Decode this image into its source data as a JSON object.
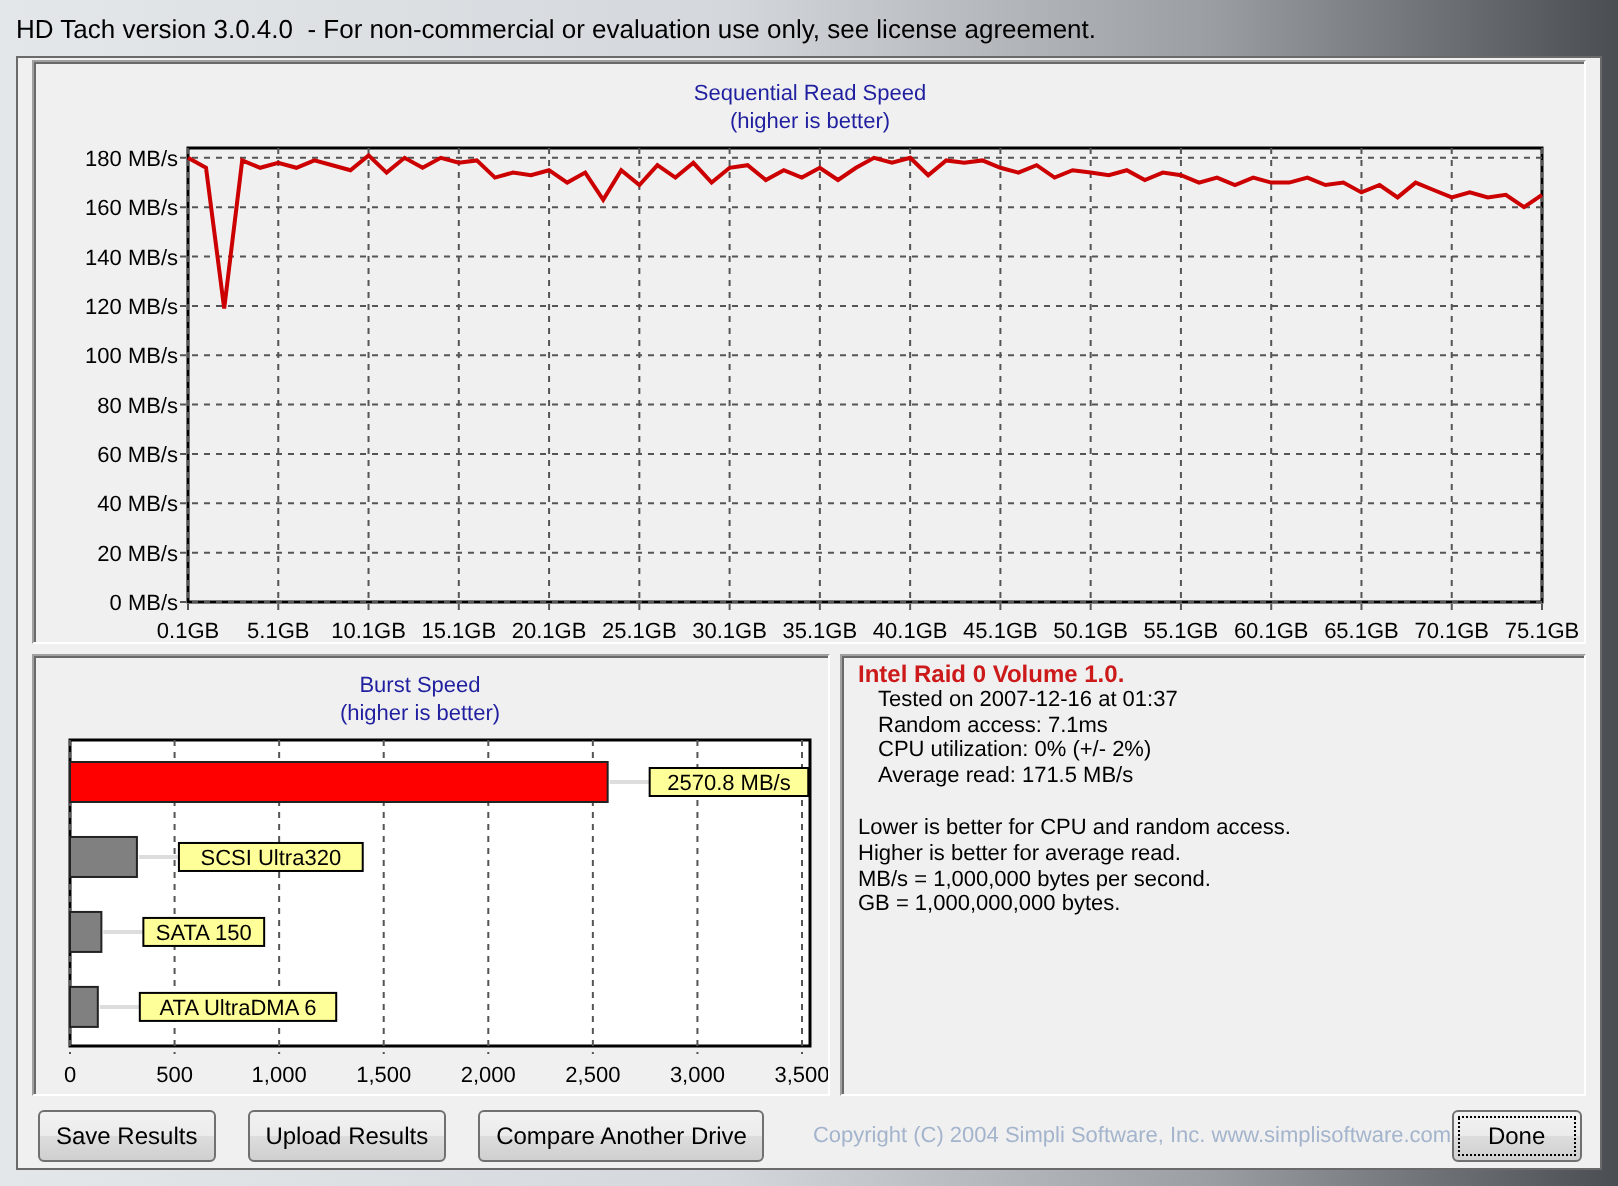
{
  "window": {
    "title": "HD Tach version 3.0.4.0  - For non-commercial or evaluation use only, see license agreement."
  },
  "read_chart": {
    "subtitle": "(higher is better)",
    "chart_data": {
      "type": "line",
      "title": "Sequential Read Speed",
      "x": [
        0.1,
        1.1,
        2.1,
        3.1,
        4.1,
        5.1,
        6.1,
        7.1,
        8.1,
        9.1,
        10.1,
        11.1,
        12.1,
        13.1,
        14.1,
        15.1,
        16.1,
        17.1,
        18.1,
        19.1,
        20.1,
        21.1,
        22.1,
        23.1,
        24.1,
        25.1,
        26.1,
        27.1,
        28.1,
        29.1,
        30.1,
        31.1,
        32.1,
        33.1,
        34.1,
        35.1,
        36.1,
        37.1,
        38.1,
        39.1,
        40.1,
        41.1,
        42.1,
        43.1,
        44.1,
        45.1,
        46.1,
        47.1,
        48.1,
        49.1,
        50.1,
        51.1,
        52.1,
        53.1,
        54.1,
        55.1,
        56.1,
        57.1,
        58.1,
        59.1,
        60.1,
        61.1,
        62.1,
        63.1,
        64.1,
        65.1,
        66.1,
        67.1,
        68.1,
        69.1,
        70.1,
        71.1,
        72.1,
        73.1,
        74.1,
        75.1
      ],
      "series": [
        {
          "color": "#cc0000",
          "values": [
            180,
            176,
            119,
            179,
            176,
            178,
            176,
            179,
            177,
            175,
            181,
            174,
            180,
            176,
            180,
            178,
            179,
            172,
            174,
            173,
            175,
            170,
            174,
            163,
            175,
            169,
            177,
            172,
            178,
            170,
            176,
            177,
            171,
            175,
            172,
            176,
            171,
            176,
            180,
            178,
            180,
            173,
            179,
            178,
            179,
            176,
            174,
            177,
            172,
            175,
            174,
            173,
            175,
            171,
            174,
            173,
            170,
            172,
            169,
            172,
            170,
            170,
            172,
            169,
            170,
            166,
            169,
            164,
            170,
            167,
            164,
            166,
            164,
            165,
            160,
            165
          ]
        }
      ],
      "xlim": [
        0.1,
        75.1
      ],
      "ylim": [
        0,
        184
      ],
      "grid": true,
      "xticks": [
        {
          "value": 0.1,
          "label": "0.1GB"
        },
        {
          "value": 5.1,
          "label": "5.1GB"
        },
        {
          "value": 10.1,
          "label": "10.1GB"
        },
        {
          "value": 15.1,
          "label": "15.1GB"
        },
        {
          "value": 20.1,
          "label": "20.1GB"
        },
        {
          "value": 25.1,
          "label": "25.1GB"
        },
        {
          "value": 30.1,
          "label": "30.1GB"
        },
        {
          "value": 35.1,
          "label": "35.1GB"
        },
        {
          "value": 40.1,
          "label": "40.1GB"
        },
        {
          "value": 45.1,
          "label": "45.1GB"
        },
        {
          "value": 50.1,
          "label": "50.1GB"
        },
        {
          "value": 55.1,
          "label": "55.1GB"
        },
        {
          "value": 60.1,
          "label": "60.1GB"
        },
        {
          "value": 65.1,
          "label": "65.1GB"
        },
        {
          "value": 70.1,
          "label": "70.1GB"
        },
        {
          "value": 75.1,
          "label": "75.1GB"
        }
      ],
      "yticks": [
        {
          "value": 0,
          "label": "0 MB/s"
        },
        {
          "value": 20,
          "label": "20 MB/s"
        },
        {
          "value": 40,
          "label": "40 MB/s"
        },
        {
          "value": 60,
          "label": "60 MB/s"
        },
        {
          "value": 80,
          "label": "80 MB/s"
        },
        {
          "value": 100,
          "label": "100 MB/s"
        },
        {
          "value": 120,
          "label": "120 MB/s"
        },
        {
          "value": 140,
          "label": "140 MB/s"
        },
        {
          "value": 160,
          "label": "160 MB/s"
        },
        {
          "value": 180,
          "label": "180 MB/s"
        }
      ]
    }
  },
  "burst_chart": {
    "subtitle": "(higher is better)",
    "chart_data": {
      "type": "bar",
      "title": "Burst Speed",
      "orientation": "horizontal",
      "categories": [
        "2570.8 MB/s",
        "SCSI Ultra320",
        "SATA 150",
        "ATA UltraDMA 6"
      ],
      "series": [
        {
          "color": "#ff0000",
          "values": [
            2570.8,
            null,
            null,
            null
          ]
        },
        {
          "color": "#808080",
          "values": [
            null,
            320,
            150,
            133
          ]
        }
      ],
      "xlim": [
        0,
        3500
      ],
      "grid": true,
      "xticks": [
        {
          "value": 0,
          "label": "0"
        },
        {
          "value": 500,
          "label": "500"
        },
        {
          "value": 1000,
          "label": "1,000"
        },
        {
          "value": 1500,
          "label": "1,500"
        },
        {
          "value": 2000,
          "label": "2,000"
        },
        {
          "value": 2500,
          "label": "2,500"
        },
        {
          "value": 3000,
          "label": "3,000"
        },
        {
          "value": 3500,
          "label": "3,500"
        }
      ]
    }
  },
  "results": {
    "drive": "Intel Raid 0 Volume 1.0.",
    "details": [
      "Tested on 2007-12-16 at 01:37",
      "Random access: 7.1ms",
      "CPU utilization: 0% (+/- 2%)",
      "Average read: 171.5 MB/s"
    ],
    "notes": [
      "Lower is better for CPU and random access.",
      "Higher is better for average read.",
      "MB/s = 1,000,000 bytes per second.",
      "GB = 1,000,000,000 bytes."
    ]
  },
  "buttons": [
    {
      "label": "Save Results"
    },
    {
      "label": "Upload Results"
    },
    {
      "label": "Compare Another Drive"
    }
  ],
  "copyright": "Copyright (C) 2004 Simpli Software, Inc. www.simplisoftware.com",
  "done_button": {
    "label": "Done",
    "focused": true
  }
}
